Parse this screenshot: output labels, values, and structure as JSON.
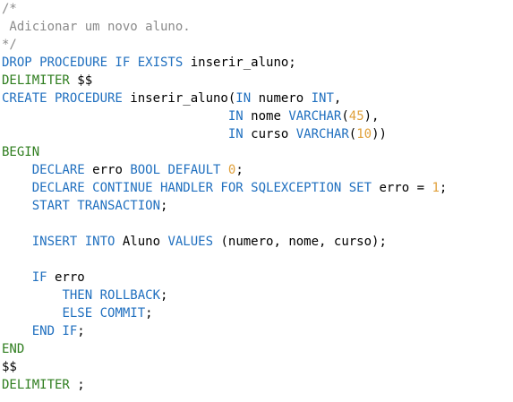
{
  "theme": {
    "keyword": "#1f6fbf",
    "comment": "#8a8a8a",
    "number": "#e0a03a",
    "delimiter": "#2e7d1e",
    "text": "#000000",
    "background": "#ffffff"
  },
  "code": {
    "lines": [
      [
        {
          "t": "/*",
          "c": "cm"
        }
      ],
      [
        {
          "t": " Adicionar um novo aluno.",
          "c": "cm"
        }
      ],
      [
        {
          "t": "*/",
          "c": "cm"
        }
      ],
      [
        {
          "t": "DROP PROCEDURE IF EXISTS",
          "c": "kw"
        },
        {
          "t": " inserir_aluno;",
          "c": "tx"
        }
      ],
      [
        {
          "t": "DELIMITER",
          "c": "dl"
        },
        {
          "t": " $$",
          "c": "tx"
        }
      ],
      [
        {
          "t": "CREATE PROCEDURE",
          "c": "kw"
        },
        {
          "t": " inserir_aluno(",
          "c": "tx"
        },
        {
          "t": "IN",
          "c": "kw"
        },
        {
          "t": " numero ",
          "c": "tx"
        },
        {
          "t": "INT",
          "c": "kw"
        },
        {
          "t": ",",
          "c": "tx"
        }
      ],
      [
        {
          "t": "                              ",
          "c": "tx"
        },
        {
          "t": "IN",
          "c": "kw"
        },
        {
          "t": " nome ",
          "c": "tx"
        },
        {
          "t": "VARCHAR",
          "c": "kw"
        },
        {
          "t": "(",
          "c": "tx"
        },
        {
          "t": "45",
          "c": "num"
        },
        {
          "t": "),",
          "c": "tx"
        }
      ],
      [
        {
          "t": "                              ",
          "c": "tx"
        },
        {
          "t": "IN",
          "c": "kw"
        },
        {
          "t": " curso ",
          "c": "tx"
        },
        {
          "t": "VARCHAR",
          "c": "kw"
        },
        {
          "t": "(",
          "c": "tx"
        },
        {
          "t": "10",
          "c": "num"
        },
        {
          "t": "))",
          "c": "tx"
        }
      ],
      [
        {
          "t": "BEGIN",
          "c": "dl"
        }
      ],
      [
        {
          "t": "    ",
          "c": "tx"
        },
        {
          "t": "DECLARE",
          "c": "kw"
        },
        {
          "t": " erro ",
          "c": "tx"
        },
        {
          "t": "BOOL DEFAULT",
          "c": "kw"
        },
        {
          "t": " ",
          "c": "tx"
        },
        {
          "t": "0",
          "c": "num"
        },
        {
          "t": ";",
          "c": "tx"
        }
      ],
      [
        {
          "t": "    ",
          "c": "tx"
        },
        {
          "t": "DECLARE CONTINUE HANDLER FOR SQLEXCEPTION SET",
          "c": "kw"
        },
        {
          "t": " erro = ",
          "c": "tx"
        },
        {
          "t": "1",
          "c": "num"
        },
        {
          "t": ";",
          "c": "tx"
        }
      ],
      [
        {
          "t": "    ",
          "c": "tx"
        },
        {
          "t": "START TRANSACTION",
          "c": "kw"
        },
        {
          "t": ";",
          "c": "tx"
        }
      ],
      [],
      [
        {
          "t": "    ",
          "c": "tx"
        },
        {
          "t": "INSERT INTO",
          "c": "kw"
        },
        {
          "t": " Aluno ",
          "c": "tx"
        },
        {
          "t": "VALUES",
          "c": "kw"
        },
        {
          "t": " (numero, nome, curso);",
          "c": "tx"
        }
      ],
      [],
      [
        {
          "t": "    ",
          "c": "tx"
        },
        {
          "t": "IF",
          "c": "kw"
        },
        {
          "t": " erro",
          "c": "tx"
        }
      ],
      [
        {
          "t": "        ",
          "c": "tx"
        },
        {
          "t": "THEN ROLLBACK",
          "c": "kw"
        },
        {
          "t": ";",
          "c": "tx"
        }
      ],
      [
        {
          "t": "        ",
          "c": "tx"
        },
        {
          "t": "ELSE COMMIT",
          "c": "kw"
        },
        {
          "t": ";",
          "c": "tx"
        }
      ],
      [
        {
          "t": "    ",
          "c": "tx"
        },
        {
          "t": "END IF",
          "c": "kw"
        },
        {
          "t": ";",
          "c": "tx"
        }
      ],
      [
        {
          "t": "END",
          "c": "dl"
        }
      ],
      [
        {
          "t": "$$",
          "c": "tx"
        }
      ],
      [
        {
          "t": "DELIMITER",
          "c": "dl"
        },
        {
          "t": " ;",
          "c": "tx"
        }
      ]
    ]
  }
}
